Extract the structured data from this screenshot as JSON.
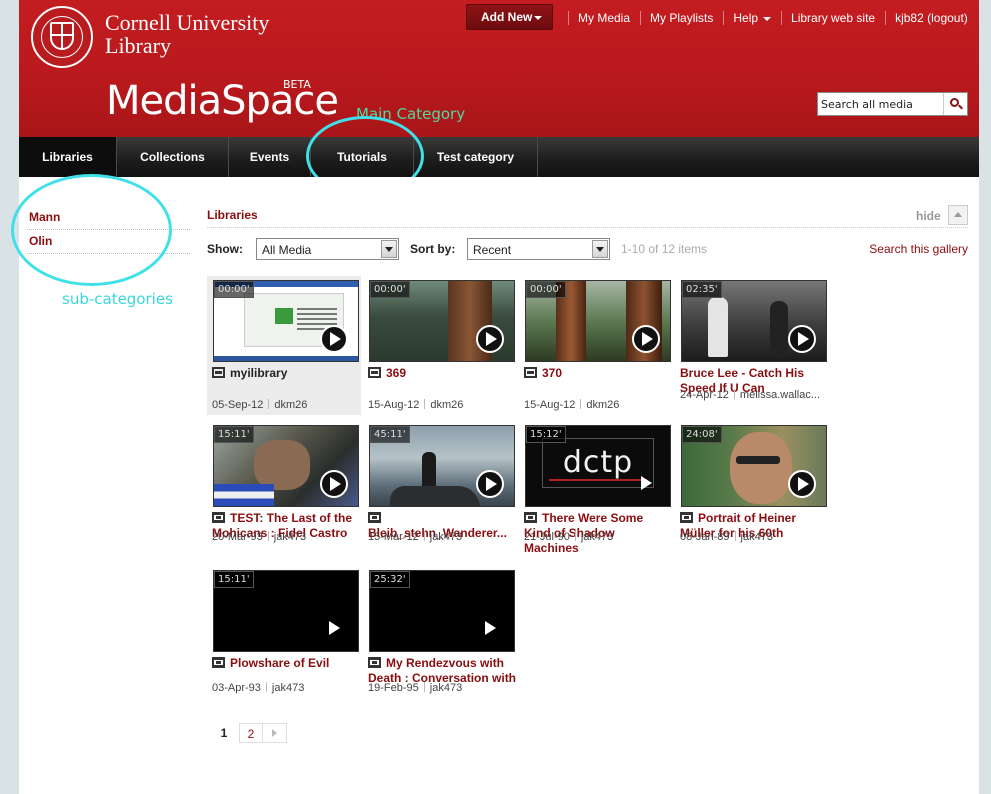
{
  "brand": {
    "university_line1": "Cornell University",
    "university_line2": "Library",
    "product": "MediaSpace",
    "badge": "BETA"
  },
  "annotations": {
    "main_category": "Main Category",
    "sub_categories": "sub-categories"
  },
  "topbar": {
    "add_new": "Add New",
    "links": [
      "My Media",
      "My Playlists",
      "Help",
      "Library web site",
      "kjb82 (logout)"
    ]
  },
  "search": {
    "placeholder": "Search all media"
  },
  "nav": {
    "tabs": [
      "Libraries",
      "Collections",
      "Events",
      "Tutorials",
      "Test category"
    ],
    "active": "Libraries"
  },
  "sidebar": {
    "items": [
      "Mann",
      "Olin"
    ]
  },
  "gallery": {
    "title": "Libraries",
    "hide": "hide",
    "show_label": "Show:",
    "show_value": "All Media",
    "sort_label": "Sort by:",
    "sort_value": "Recent",
    "count": "1-10 of 12 items",
    "search_gallery": "Search this gallery",
    "items": [
      {
        "duration": "00:00'",
        "title": "myilibrary",
        "date": "05-Sep-12",
        "user": "dkm26",
        "type": "image-icon",
        "art": "screen"
      },
      {
        "duration": "00:00'",
        "title": "369",
        "date": "15-Aug-12",
        "user": "dkm26",
        "type": "image-icon",
        "art": "forest1"
      },
      {
        "duration": "00:00'",
        "title": "370",
        "date": "15-Aug-12",
        "user": "dkm26",
        "type": "image-icon",
        "art": "forest2"
      },
      {
        "duration": "02:35'",
        "title": "Bruce Lee - Catch His Speed If U Can",
        "date": "24-Apr-12",
        "user": "melissa.wallac...",
        "type": "none",
        "art": "fight"
      },
      {
        "duration": "15:11'",
        "title": "TEST: The Last of the Mohicans : Fidel Castro",
        "date": "20-Mar-93",
        "user": "jak473",
        "type": "video-icon",
        "art": "castro"
      },
      {
        "duration": "45:11'",
        "title": "Bleib_stehn_Wanderer...",
        "date": "15-Mar-12",
        "user": "jak473",
        "type": "video-icon",
        "art": "wanderer"
      },
      {
        "duration": "15:12'",
        "title": "There Were Some Kind of Shadow Machines",
        "date": "21-Jul-90",
        "user": "jak473",
        "type": "video-icon",
        "art": "dctp",
        "art_text": "dctp"
      },
      {
        "duration": "24:08'",
        "title": "Portrait of Heiner Müller for his 60th",
        "date": "08-Jan-89",
        "user": "jak473",
        "type": "video-icon",
        "art": "muller"
      },
      {
        "duration": "15:11'",
        "title": "Plowshare of Evil",
        "date": "03-Apr-93",
        "user": "jak473",
        "type": "video-icon",
        "art": "black"
      },
      {
        "duration": "25:32'",
        "title": "My Rendezvous with Death : Conversation with",
        "date": "19-Feb-95",
        "user": "jak473",
        "type": "video-icon",
        "art": "black"
      }
    ]
  },
  "pager": {
    "current": "1",
    "next_page": "2"
  },
  "colors": {
    "brand_red": "#b8191d",
    "link_red": "#8a0d10",
    "nav_dark": "#1e1e1e",
    "annotation_green": "#4ddb9e",
    "annotation_cyan": "#40e0e8"
  }
}
